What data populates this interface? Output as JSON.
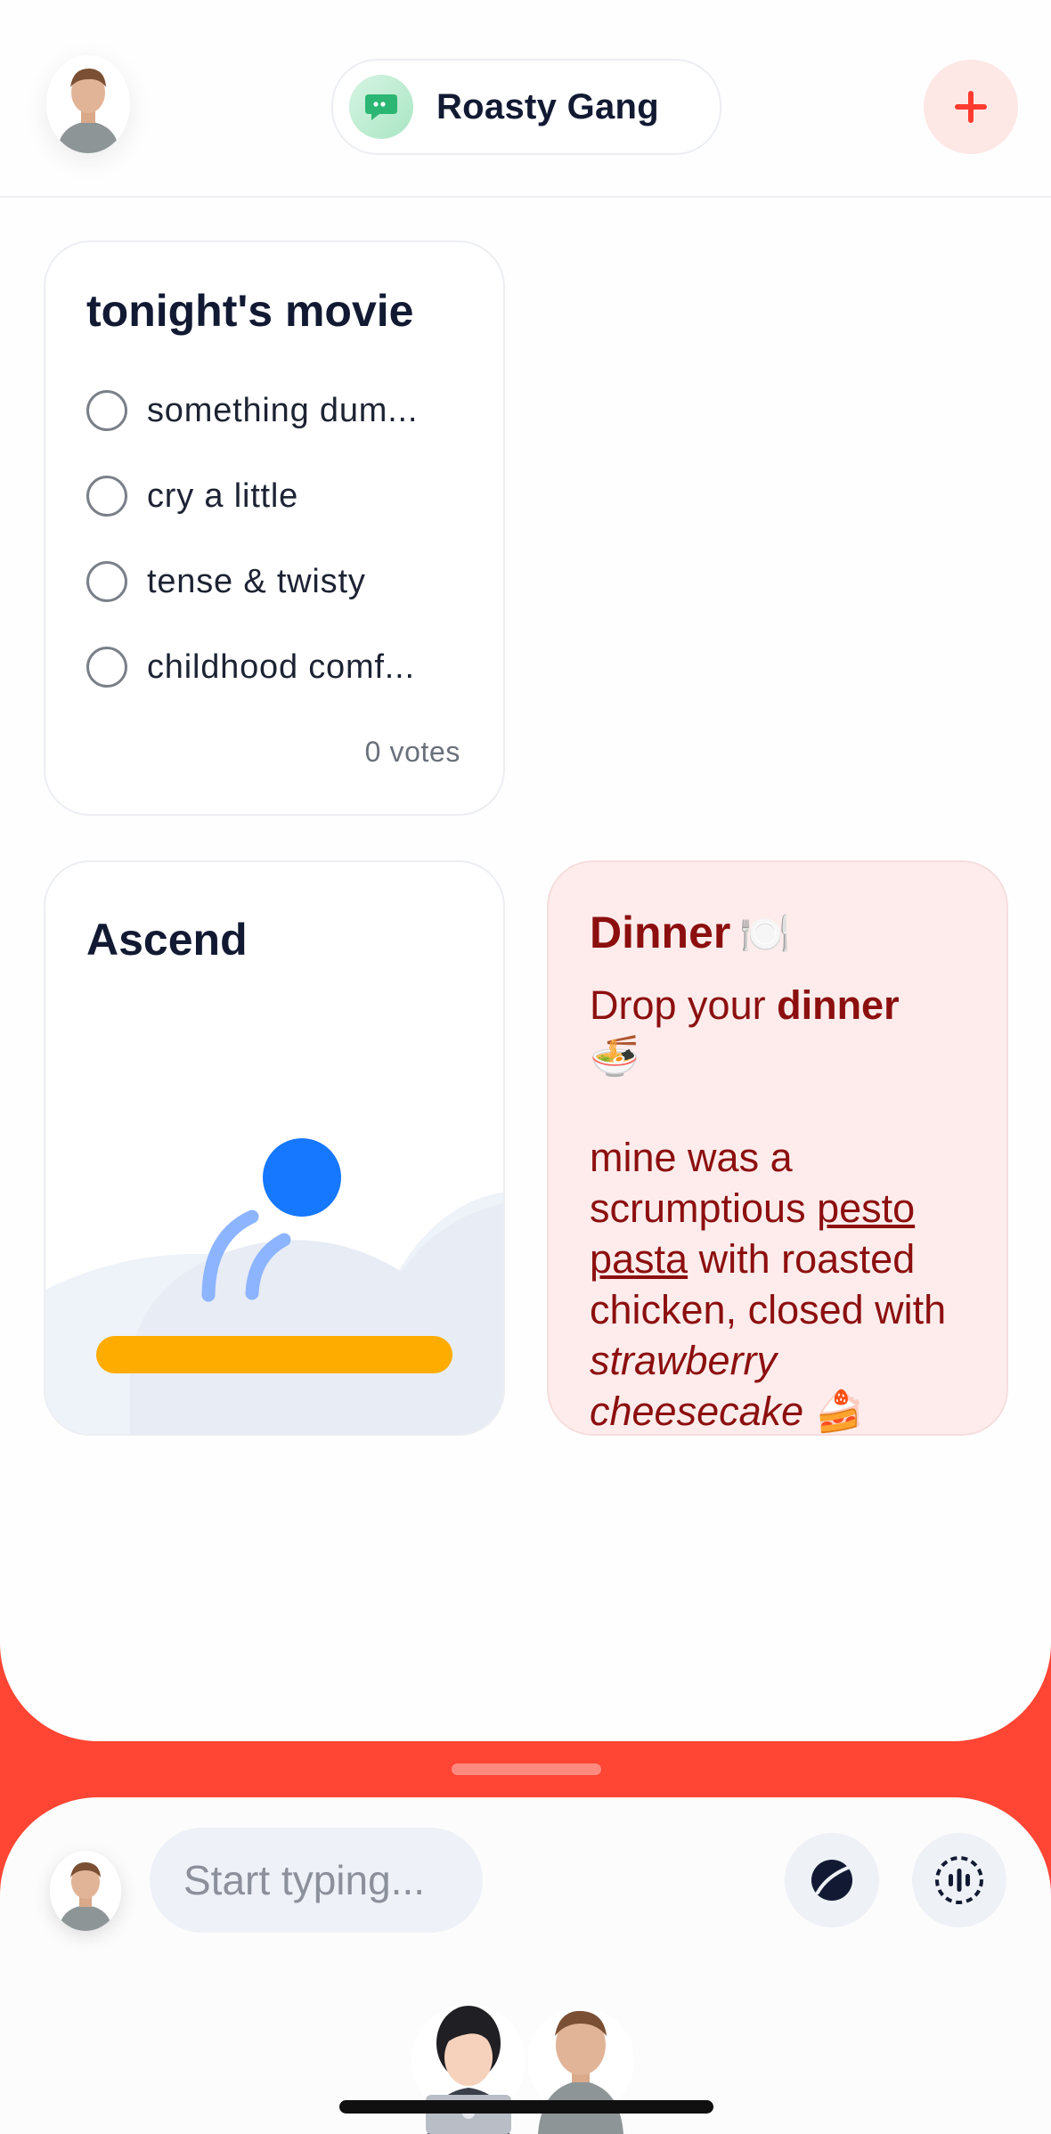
{
  "header": {
    "group_name": "Roasty Gang",
    "avatar_icon": "user-avatar-icon",
    "group_icon": "chat-bubble-icon",
    "add_icon": "plus-icon"
  },
  "poll": {
    "title": "tonight's movie",
    "options": [
      {
        "label": "something dum..."
      },
      {
        "label": "cry a little"
      },
      {
        "label": "tense & twisty"
      },
      {
        "label": "childhood comf..."
      }
    ],
    "votes": "0 votes"
  },
  "game": {
    "title": "Ascend"
  },
  "dinner": {
    "title": "Dinner",
    "title_emoji": "🍽️",
    "line1_a": "Drop your ",
    "line1_b": "dinner",
    "noodle_emoji": "🍜",
    "text_a": "mine was a scrumptious ",
    "text_pesto": "pesto pasta",
    "text_b": " with roasted chicken, closed with ",
    "text_dessert": "strawberry cheesecake",
    "cake_emoji": "🍰"
  },
  "composer": {
    "placeholder": "Start typing...",
    "sticker_icon": "sticker-icon",
    "voice_icon": "voice-record-icon"
  },
  "colors": {
    "accent_red": "#ff4533",
    "dinner_bg": "#fdeceb",
    "dinner_text": "#8c0f0f",
    "ball_blue": "#1677ff",
    "platform_yellow": "#ffac00"
  }
}
